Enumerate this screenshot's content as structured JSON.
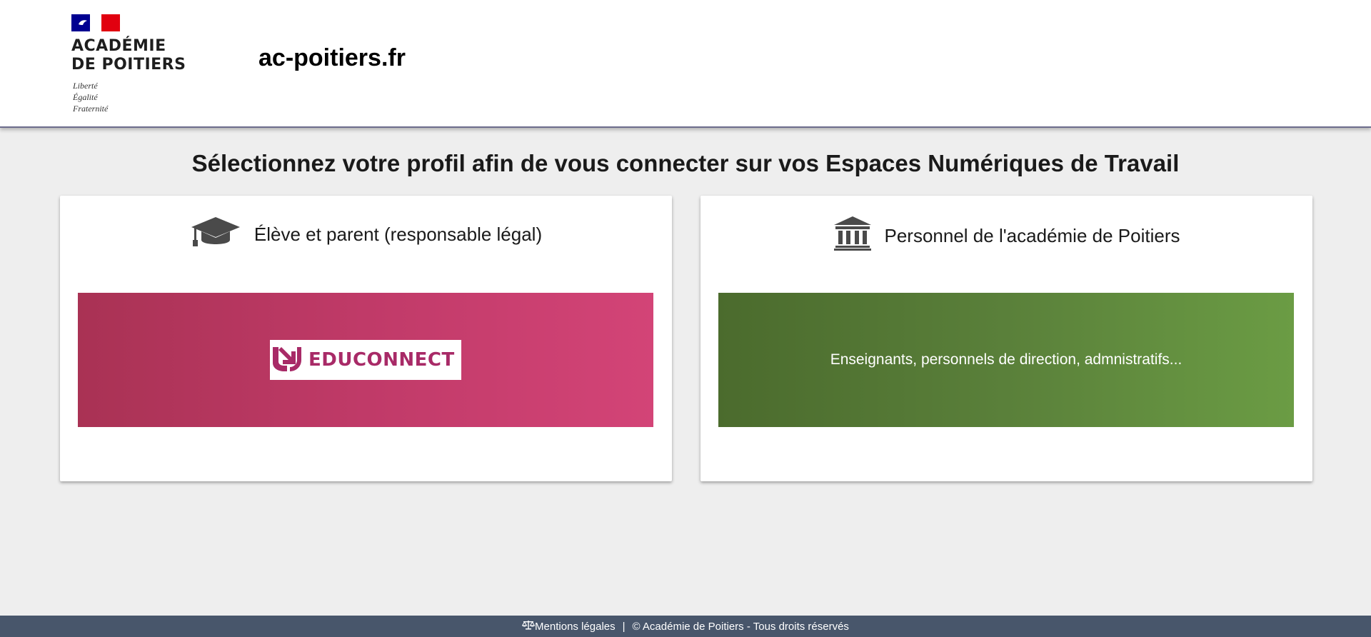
{
  "header": {
    "logo": {
      "line1": "ACADÉMIE",
      "line2": "DE POITIERS",
      "motto": [
        "Liberté",
        "Égalité",
        "Fraternité"
      ]
    },
    "site_name": "ac-poitiers.fr"
  },
  "main": {
    "heading": "Sélectionnez votre profil afin de vous connecter sur vos Espaces Numériques de Travail",
    "cards": [
      {
        "title": "Élève et parent (responsable légal)",
        "icon": "graduation-cap-icon",
        "panel_brand": "EDUCONNECT",
        "panel_color": "#c03a68"
      },
      {
        "title": "Personnel de l'académie de Poitiers",
        "icon": "institution-icon",
        "panel_text": "Enseignants, personnels de direction, admnistratifs...",
        "panel_color": "#5a803a"
      }
    ]
  },
  "footer": {
    "legal_label": "Mentions légales",
    "separator": "|",
    "copyright": "© Académie de Poitiers - Tous droits réservés"
  }
}
